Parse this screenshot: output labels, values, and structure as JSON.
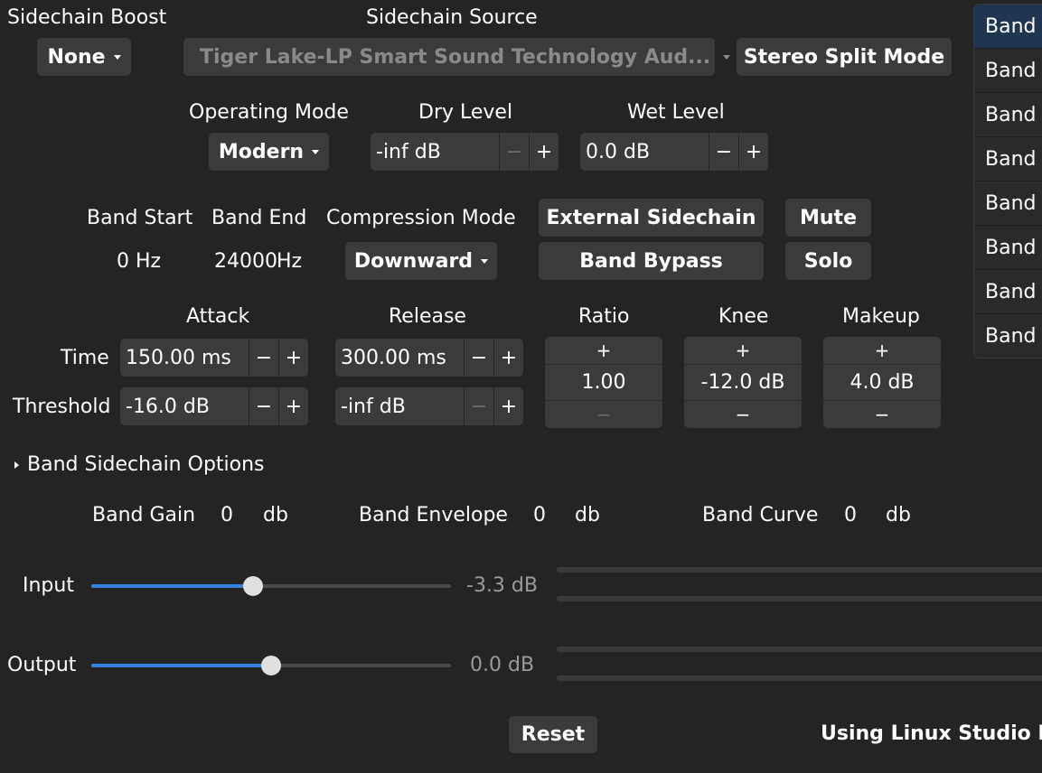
{
  "sidechain_boost": {
    "label": "Sidechain Boost",
    "value": "None"
  },
  "sidechain_source": {
    "label": "Sidechain Source",
    "value": "Tiger Lake-LP Smart Sound Technology Aud..."
  },
  "stereo_split_label": "Stereo Split Mode",
  "operating_mode": {
    "label": "Operating Mode",
    "value": "Modern"
  },
  "dry_level": {
    "label": "Dry Level",
    "value": "-inf dB"
  },
  "wet_level": {
    "label": "Wet Level",
    "value": "0.0 dB"
  },
  "band": {
    "start_label": "Band Start",
    "end_label": "Band End",
    "start_value": "0 Hz",
    "end_value": "24000",
    "end_unit": "Hz"
  },
  "compression_mode": {
    "label": "Compression Mode",
    "value": "Downward"
  },
  "buttons": {
    "external_sidechain": "External Sidechain",
    "band_bypass": "Band Bypass",
    "mute": "Mute",
    "solo": "Solo",
    "reset": "Reset"
  },
  "attack": {
    "label": "Attack",
    "time": "150.00 ms",
    "threshold": "-16.0 dB"
  },
  "release": {
    "label": "Release",
    "time": "300.00 ms",
    "threshold": "-inf dB"
  },
  "row_labels": {
    "time": "Time",
    "threshold": "Threshold"
  },
  "ratio": {
    "label": "Ratio",
    "value": "1.00"
  },
  "knee": {
    "label": "Knee",
    "value": "-12.0 dB"
  },
  "makeup": {
    "label": "Makeup",
    "value": "4.0 dB"
  },
  "spin_plus": "+",
  "spin_minus": "−",
  "sidechain_options_label": "Band Sidechain Options",
  "readouts": {
    "gain": {
      "label": "Band Gain",
      "value": "0",
      "unit": "db"
    },
    "envelope": {
      "label": "Band Envelope",
      "value": "0",
      "unit": "db"
    },
    "curve": {
      "label": "Band Curve",
      "value": "0",
      "unit": "db"
    }
  },
  "input": {
    "label": "Input",
    "value": "-3.3 dB",
    "level": 0.45
  },
  "output": {
    "label": "Output",
    "value": "0.0 dB",
    "level": 0.5
  },
  "footer_text": "Using Linux Studio Pl",
  "bands": [
    "Band",
    "Band",
    "Band",
    "Band",
    "Band",
    "Band",
    "Band",
    "Band"
  ],
  "colors": {
    "accent": "#3584e4",
    "background": "#242424",
    "button": "#3b3b3b",
    "selected": "#1f3550"
  }
}
